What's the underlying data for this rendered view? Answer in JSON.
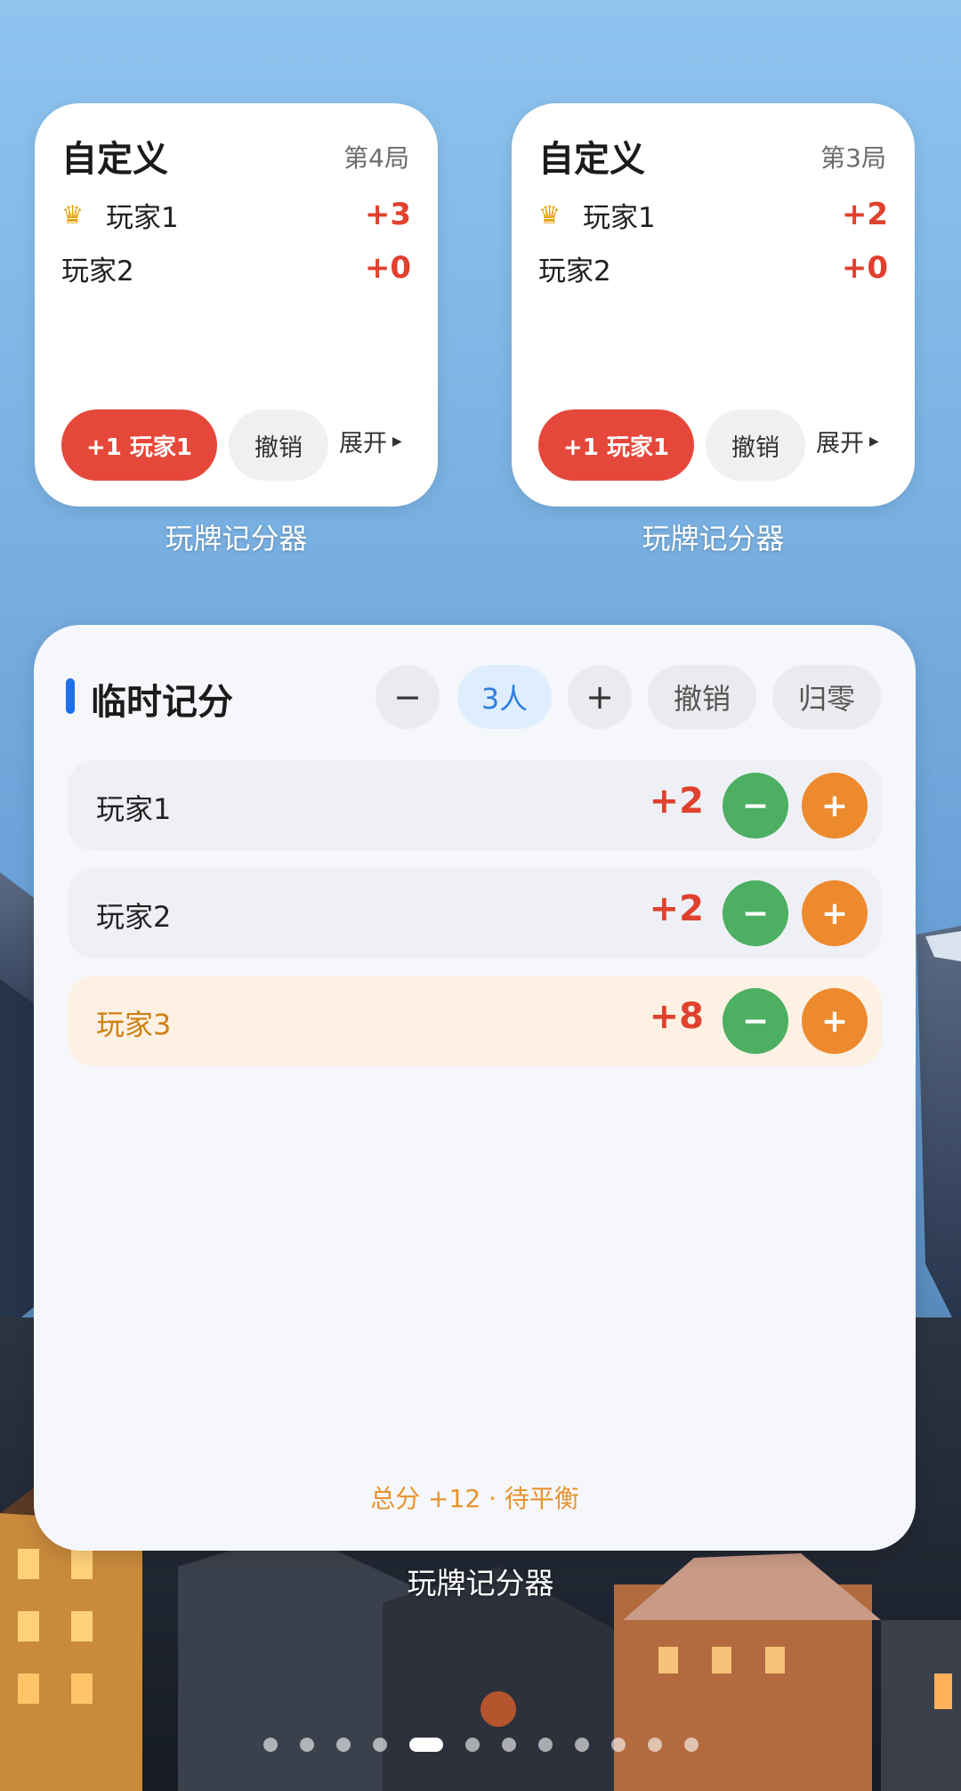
{
  "widgets_small": [
    {
      "title": "自定义",
      "round": "第4局",
      "players": [
        {
          "crown": true,
          "name": "玩家1",
          "score": "+3"
        },
        {
          "crown": false,
          "name": "玩家2",
          "score": "+0"
        }
      ],
      "add_button": "+1 玩家1",
      "undo_button": "撤销",
      "expand_button": "展开",
      "label": "玩牌记分器"
    },
    {
      "title": "自定义",
      "round": "第3局",
      "players": [
        {
          "crown": true,
          "name": "玩家1",
          "score": "+2"
        },
        {
          "crown": false,
          "name": "玩家2",
          "score": "+0"
        }
      ],
      "add_button": "+1 玩家1",
      "undo_button": "撤销",
      "expand_button": "展开",
      "label": "玩牌记分器"
    }
  ],
  "widget_large": {
    "title": "临时记分",
    "decrease_players": "−",
    "player_count": "3人",
    "increase_players": "+",
    "undo_button": "撤销",
    "reset_button": "归零",
    "rows": [
      {
        "name": "玩家1",
        "score": "+2",
        "highlight": false
      },
      {
        "name": "玩家2",
        "score": "+2",
        "highlight": false
      },
      {
        "name": "玩家3",
        "score": "+8",
        "highlight": true
      }
    ],
    "row_minus": "−",
    "row_plus": "+",
    "footer": "总分 +12 · 待平衡",
    "label": "玩牌记分器"
  },
  "page_dots": {
    "count": 12,
    "active_index": 4
  },
  "colors": {
    "accent_red": "#e0412e",
    "accent_blue": "#2f7fe0",
    "green": "#4caf62",
    "orange": "#ee8a2e"
  },
  "icons": {
    "crown": "crown-icon"
  }
}
